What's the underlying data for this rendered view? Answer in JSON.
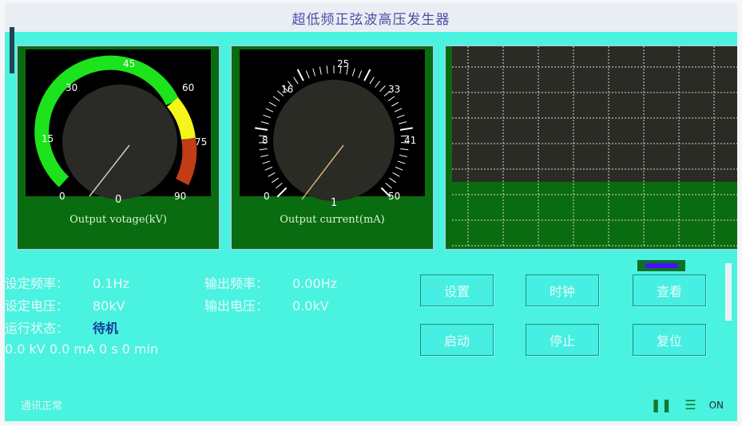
{
  "app": {
    "title": "超低频正弦波高压发生器"
  },
  "voltage_gauge": {
    "caption": "Output votage(kV)",
    "ticks": [
      "0",
      "15",
      "30",
      "45",
      "60",
      "75",
      "90"
    ],
    "reading": "0",
    "value_kv": 0
  },
  "current_gauge": {
    "caption": "Output current(mA)",
    "ticks": [
      "0",
      "8",
      "16",
      "25",
      "33",
      "41",
      "50"
    ],
    "reading": "1",
    "value_ma": 0
  },
  "info": {
    "row1_label": "设定频率：",
    "row1_value": "0.1Hz",
    "row1_label2": "输出频率：",
    "row1_value2": "0.00Hz",
    "row2_label": "设定电压：",
    "row2_value": "80kV",
    "row2_label2": "输出电压：",
    "row2_value2": "0.0kV",
    "row3_label": "运行状态：",
    "row3_value": "待机",
    "row4_text": "0.0 kV    0.0 mA    0 s    0 min"
  },
  "buttons": {
    "setup": "设置",
    "clock": "时钟",
    "view": "查看",
    "start": "启动",
    "stop": "停止",
    "reset": "复位"
  },
  "footer": {
    "status": "通讯正常",
    "tag": "ON"
  },
  "colors": {
    "background": "#4af2e0",
    "panel": "#0a6c10",
    "gauge_green": "#1ce31c",
    "gauge_yellow": "#f5f51a",
    "gauge_red": "#c23c16"
  }
}
